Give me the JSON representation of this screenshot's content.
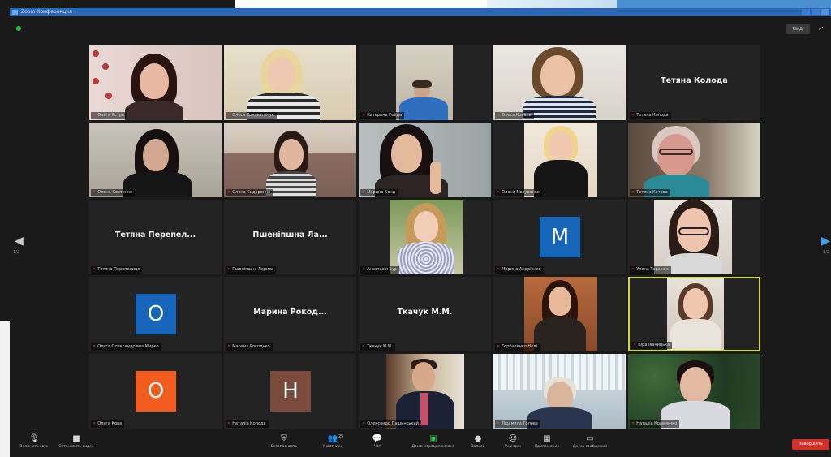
{
  "window": {
    "title": "Zoom Конференция"
  },
  "header": {
    "view_label": "Вид"
  },
  "nav": {
    "left_label": "1/2",
    "right_label": "1/2"
  },
  "tiles": [
    {
      "name_big": "",
      "label": "Ольга Ястре"
    },
    {
      "name_big": "",
      "label": "Олеся Коновальчук"
    },
    {
      "name_big": "",
      "label": "Катерина Гейда"
    },
    {
      "name_big": "",
      "label": "Олеся Коваль"
    },
    {
      "name_big": "Тетяна Колода",
      "label": "Тетяна Колода"
    },
    {
      "name_big": "",
      "label": "Олена Костенко"
    },
    {
      "name_big": "",
      "label": "Олена Сидоренко"
    },
    {
      "name_big": "",
      "label": "Марина Бонд"
    },
    {
      "name_big": "",
      "label": "Олена Мазуренко"
    },
    {
      "name_big": "",
      "label": "Тетяна Котова"
    },
    {
      "name_big": "Тетяна Перепел...",
      "label": "Тетяна Перепелиця"
    },
    {
      "name_big": "Пшеніпшна Ла...",
      "label": "Пшеніпшна Лариса"
    },
    {
      "name_big": "",
      "label": "Анастасія Бур"
    },
    {
      "name_big": "",
      "label": "Марина Андрієнко",
      "initial": "M"
    },
    {
      "name_big": "",
      "label": "Уляна Тарасюк"
    },
    {
      "name_big": "",
      "label": "Ольга Олександрівна Мирко",
      "initial": "O"
    },
    {
      "name_big": "Марина Рокод...",
      "label": "Марина Рокодько"
    },
    {
      "name_big": "Ткачук М.М.",
      "label": "Ткачук М.М."
    },
    {
      "name_big": "",
      "label": "Горбатенко Нелі"
    },
    {
      "name_big": "",
      "label": "Віра Іваницька"
    },
    {
      "name_big": "",
      "label": "Ольга Кова",
      "initial": "O"
    },
    {
      "name_big": "",
      "label": "Наталія Колода",
      "initial": "H"
    },
    {
      "name_big": "",
      "label": "Олександр Пашинський"
    },
    {
      "name_big": "",
      "label": "Людмила Голова"
    },
    {
      "name_big": "",
      "label": "Наталія Кравченко"
    }
  ],
  "toolbar": {
    "mute": "Включить звук",
    "video": "Остановить видео",
    "security": "Безопасность",
    "participants": "Участники",
    "participants_count": "25",
    "chat": "Чат",
    "share": "Демонстрация экрана",
    "record": "Запись",
    "reactions": "Реакции",
    "apps": "Приложения",
    "whiteboard": "Доска сообщений",
    "end": "Завершить"
  },
  "colors": {
    "accent_blue": "#1565b8",
    "avatar_orange": "#f25c1e",
    "avatar_brown": "#7a4a3a",
    "share_green": "#2fbf4b",
    "end_red": "#d3302a",
    "active_border": "#c9d94a"
  }
}
